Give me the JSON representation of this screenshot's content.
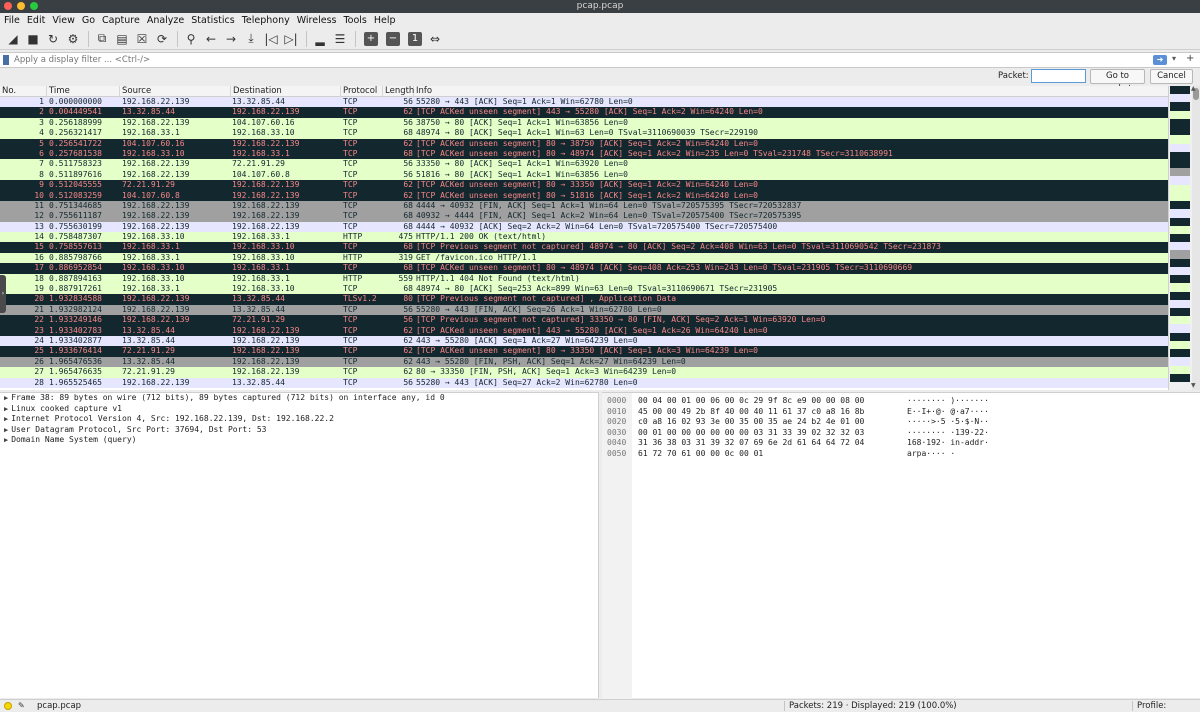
{
  "window": {
    "title": "pcap.pcap"
  },
  "traffic_lights": [
    "#ff5f57",
    "#febc2e",
    "#28c840"
  ],
  "menu": [
    "File",
    "Edit",
    "View",
    "Go",
    "Capture",
    "Analyze",
    "Statistics",
    "Telephony",
    "Wireless",
    "Tools",
    "Help"
  ],
  "toolbar": {
    "icons": [
      "shark-fin-start-icon",
      "stop-icon",
      "restart-icon",
      "options-icon",
      "open-file-icon",
      "save-file-icon",
      "close-file-icon",
      "reload-icon",
      "find-icon",
      "back-arrow-icon",
      "forward-arrow-icon",
      "go-to-packet-icon",
      "first-packet-icon",
      "last-packet-icon",
      "autoscroll-icon",
      "colorize-icon",
      "zoom-in-icon",
      "zoom-out-icon",
      "normal-size-icon",
      "resize-columns-icon"
    ],
    "glyphs": [
      "◢",
      "■",
      "↻",
      "⚙",
      "⧉",
      "▤",
      "☒",
      "⟳",
      "⚲",
      "←",
      "→",
      "⤓",
      "|◁",
      "▷|",
      "▂",
      "☰",
      "+",
      "−",
      "1",
      "⇔"
    ]
  },
  "filter": {
    "placeholder": "Apply a display filter ... <Ctrl-/>"
  },
  "goto": {
    "label": "Packet:",
    "value": "",
    "go_label": "Go to packet",
    "cancel_label": "Cancel"
  },
  "columns": {
    "no": "No.",
    "time": "Time",
    "source": "Source",
    "destination": "Destination",
    "protocol": "Protocol",
    "length": "Length",
    "info": "Info"
  },
  "packets": [
    {
      "no": "1",
      "time": "0.000000000",
      "src": "192.168.22.139",
      "dst": "13.32.85.44",
      "proto": "TCP",
      "len": "56",
      "info": "55280 → 443 [ACK] Seq=1 Ack=1 Win=62780 Len=0",
      "style": "lav"
    },
    {
      "no": "2",
      "time": "0.004449541",
      "src": "13.32.85.44",
      "dst": "192.168.22.139",
      "proto": "TCP",
      "len": "62",
      "info": "[TCP ACKed unseen segment] 443 → 55280 [ACK] Seq=1 Ack=2 Win=64240 Len=0",
      "style": "blk"
    },
    {
      "no": "3",
      "time": "0.256188999",
      "src": "192.168.22.139",
      "dst": "104.107.60.16",
      "proto": "TCP",
      "len": "56",
      "info": "38750 → 80 [ACK] Seq=1 Ack=1 Win=63856 Len=0",
      "style": "grn"
    },
    {
      "no": "4",
      "time": "0.256321417",
      "src": "192.168.33.1",
      "dst": "192.168.33.10",
      "proto": "TCP",
      "len": "68",
      "info": "48974 → 80 [ACK] Seq=1 Ack=1 Win=63 Len=0 TSval=3110690039 TSecr=229190",
      "style": "grn"
    },
    {
      "no": "5",
      "time": "0.256541722",
      "src": "104.107.60.16",
      "dst": "192.168.22.139",
      "proto": "TCP",
      "len": "62",
      "info": "[TCP ACKed unseen segment] 80 → 38750 [ACK] Seq=1 Ack=2 Win=64240 Len=0",
      "style": "blk"
    },
    {
      "no": "6",
      "time": "0.257681538",
      "src": "192.168.33.10",
      "dst": "192.168.33.1",
      "proto": "TCP",
      "len": "68",
      "info": "[TCP ACKed unseen segment] 80 → 48974 [ACK] Seq=1 Ack=2 Win=235 Len=0 TSval=231748 TSecr=3110638991",
      "style": "blk"
    },
    {
      "no": "7",
      "time": "0.511758323",
      "src": "192.168.22.139",
      "dst": "72.21.91.29",
      "proto": "TCP",
      "len": "56",
      "info": "33350 → 80 [ACK] Seq=1 Ack=1 Win=63920 Len=0",
      "style": "grn"
    },
    {
      "no": "8",
      "time": "0.511897616",
      "src": "192.168.22.139",
      "dst": "104.107.60.8",
      "proto": "TCP",
      "len": "56",
      "info": "51816 → 80 [ACK] Seq=1 Ack=1 Win=63856 Len=0",
      "style": "grn"
    },
    {
      "no": "9",
      "time": "0.512045555",
      "src": "72.21.91.29",
      "dst": "192.168.22.139",
      "proto": "TCP",
      "len": "62",
      "info": "[TCP ACKed unseen segment] 80 → 33350 [ACK] Seq=1 Ack=2 Win=64240 Len=0",
      "style": "blk"
    },
    {
      "no": "10",
      "time": "0.512083259",
      "src": "104.107.60.8",
      "dst": "192.168.22.139",
      "proto": "TCP",
      "len": "62",
      "info": "[TCP ACKed unseen segment] 80 → 51816 [ACK] Seq=1 Ack=2 Win=64240 Len=0",
      "style": "blk"
    },
    {
      "no": "11",
      "time": "0.751344685",
      "src": "192.168.22.139",
      "dst": "192.168.22.139",
      "proto": "TCP",
      "len": "68",
      "info": "4444 → 40932 [FIN, ACK] Seq=1 Ack=1 Win=64 Len=0 TSval=720575395 TSecr=720532837",
      "style": "gry"
    },
    {
      "no": "12",
      "time": "0.755611187",
      "src": "192.168.22.139",
      "dst": "192.168.22.139",
      "proto": "TCP",
      "len": "68",
      "info": "40932 → 4444 [FIN, ACK] Seq=1 Ack=2 Win=64 Len=0 TSval=720575400 TSecr=720575395",
      "style": "gry"
    },
    {
      "no": "13",
      "time": "0.755630199",
      "src": "192.168.22.139",
      "dst": "192.168.22.139",
      "proto": "TCP",
      "len": "68",
      "info": "4444 → 40932 [ACK] Seq=2 Ack=2 Win=64 Len=0 TSval=720575400 TSecr=720575400",
      "style": "lav"
    },
    {
      "no": "14",
      "time": "0.758487307",
      "src": "192.168.33.10",
      "dst": "192.168.33.1",
      "proto": "HTTP",
      "len": "475",
      "info": "HTTP/1.1 200 OK  (text/html)",
      "style": "grn"
    },
    {
      "no": "15",
      "time": "0.758557613",
      "src": "192.168.33.1",
      "dst": "192.168.33.10",
      "proto": "TCP",
      "len": "68",
      "info": "[TCP Previous segment not captured] 48974 → 80 [ACK] Seq=2 Ack=408 Win=63 Len=0 TSval=3110690542 TSecr=231873",
      "style": "blk"
    },
    {
      "no": "16",
      "time": "0.885798766",
      "src": "192.168.33.1",
      "dst": "192.168.33.10",
      "proto": "HTTP",
      "len": "319",
      "info": "GET /favicon.ico HTTP/1.1",
      "style": "grn"
    },
    {
      "no": "17",
      "time": "0.886952854",
      "src": "192.168.33.10",
      "dst": "192.168.33.1",
      "proto": "TCP",
      "len": "68",
      "info": "[TCP ACKed unseen segment] 80 → 48974 [ACK] Seq=408 Ack=253 Win=243 Len=0 TSval=231905 TSecr=3110690669",
      "style": "blk"
    },
    {
      "no": "18",
      "time": "0.887894163",
      "src": "192.168.33.10",
      "dst": "192.168.33.1",
      "proto": "HTTP",
      "len": "559",
      "info": "HTTP/1.1 404 Not Found  (text/html)",
      "style": "grn"
    },
    {
      "no": "19",
      "time": "0.887917261",
      "src": "192.168.33.1",
      "dst": "192.168.33.10",
      "proto": "TCP",
      "len": "68",
      "info": "48974 → 80 [ACK] Seq=253 Ack=899 Win=63 Len=0 TSval=3110690671 TSecr=231905",
      "style": "grn"
    },
    {
      "no": "20",
      "time": "1.932834588",
      "src": "192.168.22.139",
      "dst": "13.32.85.44",
      "proto": "TLSv1.2",
      "len": "80",
      "info": "[TCP Previous segment not captured] , Application Data",
      "style": "blk"
    },
    {
      "no": "21",
      "time": "1.932982124",
      "src": "192.168.22.139",
      "dst": "13.32.85.44",
      "proto": "TCP",
      "len": "56",
      "info": "55280 → 443 [FIN, ACK] Seq=26 Ack=1 Win=62780 Len=0",
      "style": "gry"
    },
    {
      "no": "22",
      "time": "1.933249146",
      "src": "192.168.22.139",
      "dst": "72.21.91.29",
      "proto": "TCP",
      "len": "56",
      "info": "[TCP Previous segment not captured] 33350 → 80 [FIN, ACK] Seq=2 Ack=1 Win=63920 Len=0",
      "style": "blk"
    },
    {
      "no": "23",
      "time": "1.933402783",
      "src": "13.32.85.44",
      "dst": "192.168.22.139",
      "proto": "TCP",
      "len": "62",
      "info": "[TCP ACKed unseen segment] 443 → 55280 [ACK] Seq=1 Ack=26 Win=64240 Len=0",
      "style": "blk"
    },
    {
      "no": "24",
      "time": "1.933402877",
      "src": "13.32.85.44",
      "dst": "192.168.22.139",
      "proto": "TCP",
      "len": "62",
      "info": "443 → 55280 [ACK] Seq=1 Ack=27 Win=64239 Len=0",
      "style": "lav"
    },
    {
      "no": "25",
      "time": "1.933676414",
      "src": "72.21.91.29",
      "dst": "192.168.22.139",
      "proto": "TCP",
      "len": "62",
      "info": "[TCP ACKed unseen segment] 80 → 33350 [ACK] Seq=1 Ack=3 Win=64239 Len=0",
      "style": "blk"
    },
    {
      "no": "26",
      "time": "1.965476536",
      "src": "13.32.85.44",
      "dst": "192.168.22.139",
      "proto": "TCP",
      "len": "62",
      "info": "443 → 55280 [FIN, PSH, ACK] Seq=1 Ack=27 Win=64239 Len=0",
      "style": "gry"
    },
    {
      "no": "27",
      "time": "1.965476635",
      "src": "72.21.91.29",
      "dst": "192.168.22.139",
      "proto": "TCP",
      "len": "62",
      "info": "80 → 33350 [FIN, PSH, ACK] Seq=1 Ack=3 Win=64239 Len=0",
      "style": "grn"
    },
    {
      "no": "28",
      "time": "1.965525465",
      "src": "192.168.22.139",
      "dst": "13.32.85.44",
      "proto": "TCP",
      "len": "56",
      "info": "55280 → 443 [ACK] Seq=27 Ack=2 Win=62780 Len=0",
      "style": "lav"
    }
  ],
  "details": [
    "Frame 38: 89 bytes on wire (712 bits), 89 bytes captured (712 bits) on interface any, id 0",
    "Linux cooked capture v1",
    "Internet Protocol Version 4, Src: 192.168.22.139, Dst: 192.168.22.2",
    "User Datagram Protocol, Src Port: 37694, Dst Port: 53",
    "Domain Name System (query)"
  ],
  "bytes": [
    {
      "offset": "0000",
      "hex": "00 04 00 01 00 06 00 0c  29 9f 8c e9 00 00 08 00",
      "ascii": "········ )·······"
    },
    {
      "offset": "0010",
      "hex": "45 00 00 49 2b 8f 40 00  40 11 61 37 c0 a8 16 8b",
      "ascii": "E··I+·@· @·a7····"
    },
    {
      "offset": "0020",
      "hex": "c0 a8 16 02 93 3e 00 35  00 35 ae 24 b2 4e 01 00",
      "ascii": "·····>·5 ·5·$·N··"
    },
    {
      "offset": "0030",
      "hex": "00 01 00 00 00 00 00 00  03 31 33 39 02 32 32 03",
      "ascii": "········ ·139·22·"
    },
    {
      "offset": "0040",
      "hex": "31 36 38 03 31 39 32 07  69 6e 2d 61 64 64 72 04",
      "ascii": "168·192· in-addr·"
    },
    {
      "offset": "0050",
      "hex": "61 72 70 61 00 00 0c 00  01",
      "ascii": "arpa···· ·"
    }
  ],
  "status": {
    "file": "pcap.pcap",
    "packets": "Packets: 219 · Displayed: 219 (100.0%)",
    "profile": "Profile: Default"
  },
  "row_colors": {
    "lav": "#e7e6ff",
    "grn": "#e4ffc7",
    "blk": "#12272e",
    "gry": "#a0a0a0",
    "blk_text": "#f78787"
  }
}
